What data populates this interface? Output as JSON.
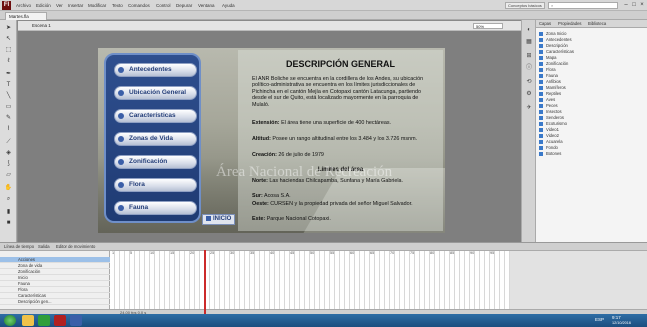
{
  "app": {
    "logo": "Fl"
  },
  "menu": [
    "Archivo",
    "Edición",
    "Ver",
    "Insertar",
    "Modificar",
    "Texto",
    "Comandos",
    "Control",
    "Depurar",
    "Ventana",
    "Ayuda"
  ],
  "workspace": "Conceptos básicos",
  "document_tab": "Martes.fla",
  "stage": {
    "scene": "Escena 1",
    "zoom": "50%"
  },
  "canvas": {
    "menu_buttons": [
      "Antecedentes",
      "Ubicación General",
      "Características",
      "Zonas de Vida",
      "Zonificación",
      "Flora",
      "Fauna"
    ],
    "home_button": "INICIO",
    "title": "DESCRIPCIÓN GENERAL",
    "intro": "El ANR Boliche se encuentra en la cordillera de los Andes, su ubicación político-administrativa se encuentra en los límites jurisdiccionales de Pichincha en el cantón Mejía en Cotopaxi cantón Latacunga, partiendo desde el sur de Quito, está localizado mayormente en la parroquia de Mulaló.",
    "extension_label": "Extensión:",
    "extension_text": "El área tiene una superficie de 400 hectáreas.",
    "altitude_label": "Altitud:",
    "altitude_text": "Posee un rango altitudinal entre los 3.484 y los 3.726 msnm.",
    "creation_label": "Creación:",
    "creation_text": "26 de julio de 1979",
    "limits_title": "Límites del área",
    "north_label": "Norte:",
    "north_text": "Las haciendas Chilcapamba, Sunfana y María Gabriela.",
    "south_label": "Sur:",
    "south_text": "Acosa S.A.",
    "west_label": "Oeste:",
    "west_text": "CURSEN y la propiedad privada del señor Miguel Salvador.",
    "east_label": "Este:",
    "east_text": "Parque Nacional Cotopaxi.",
    "watermark": "Área Nacional de Recreación"
  },
  "library": {
    "tabs": [
      "Capas",
      "Propiedades",
      "Biblioteca"
    ],
    "items": [
      "Zona Inicio",
      "Antecedentes",
      "Descripción",
      "Características",
      "Mapa",
      "Zonificación",
      "Flora",
      "Fauna",
      "Anfibios",
      "Mamíferos",
      "Reptiles",
      "Aves",
      "Peces",
      "Insectos",
      "Senderos",
      "Ecoturismo",
      "Video1",
      "Video2",
      "Acuarela",
      "Fondo",
      "Botones"
    ]
  },
  "timeline": {
    "tabs": [
      "Línea de tiempo",
      "Salida",
      "Editor de movimiento"
    ],
    "layers": [
      "Acciones",
      "Zona de vida",
      "Zonificación",
      "Inicio",
      "Fauna",
      "Flora",
      "Características",
      "Descripción gen..."
    ],
    "frame_numbers": [
      "1",
      "5",
      "10",
      "15",
      "20",
      "25",
      "30",
      "35",
      "40",
      "45",
      "50",
      "55",
      "60",
      "65",
      "70",
      "75",
      "80",
      "85",
      "90",
      "95"
    ],
    "footer": "24.00 fps   0.0 s"
  },
  "taskbar": {
    "lang": "ESP",
    "time": "9:17",
    "date": "12/10/2016"
  }
}
